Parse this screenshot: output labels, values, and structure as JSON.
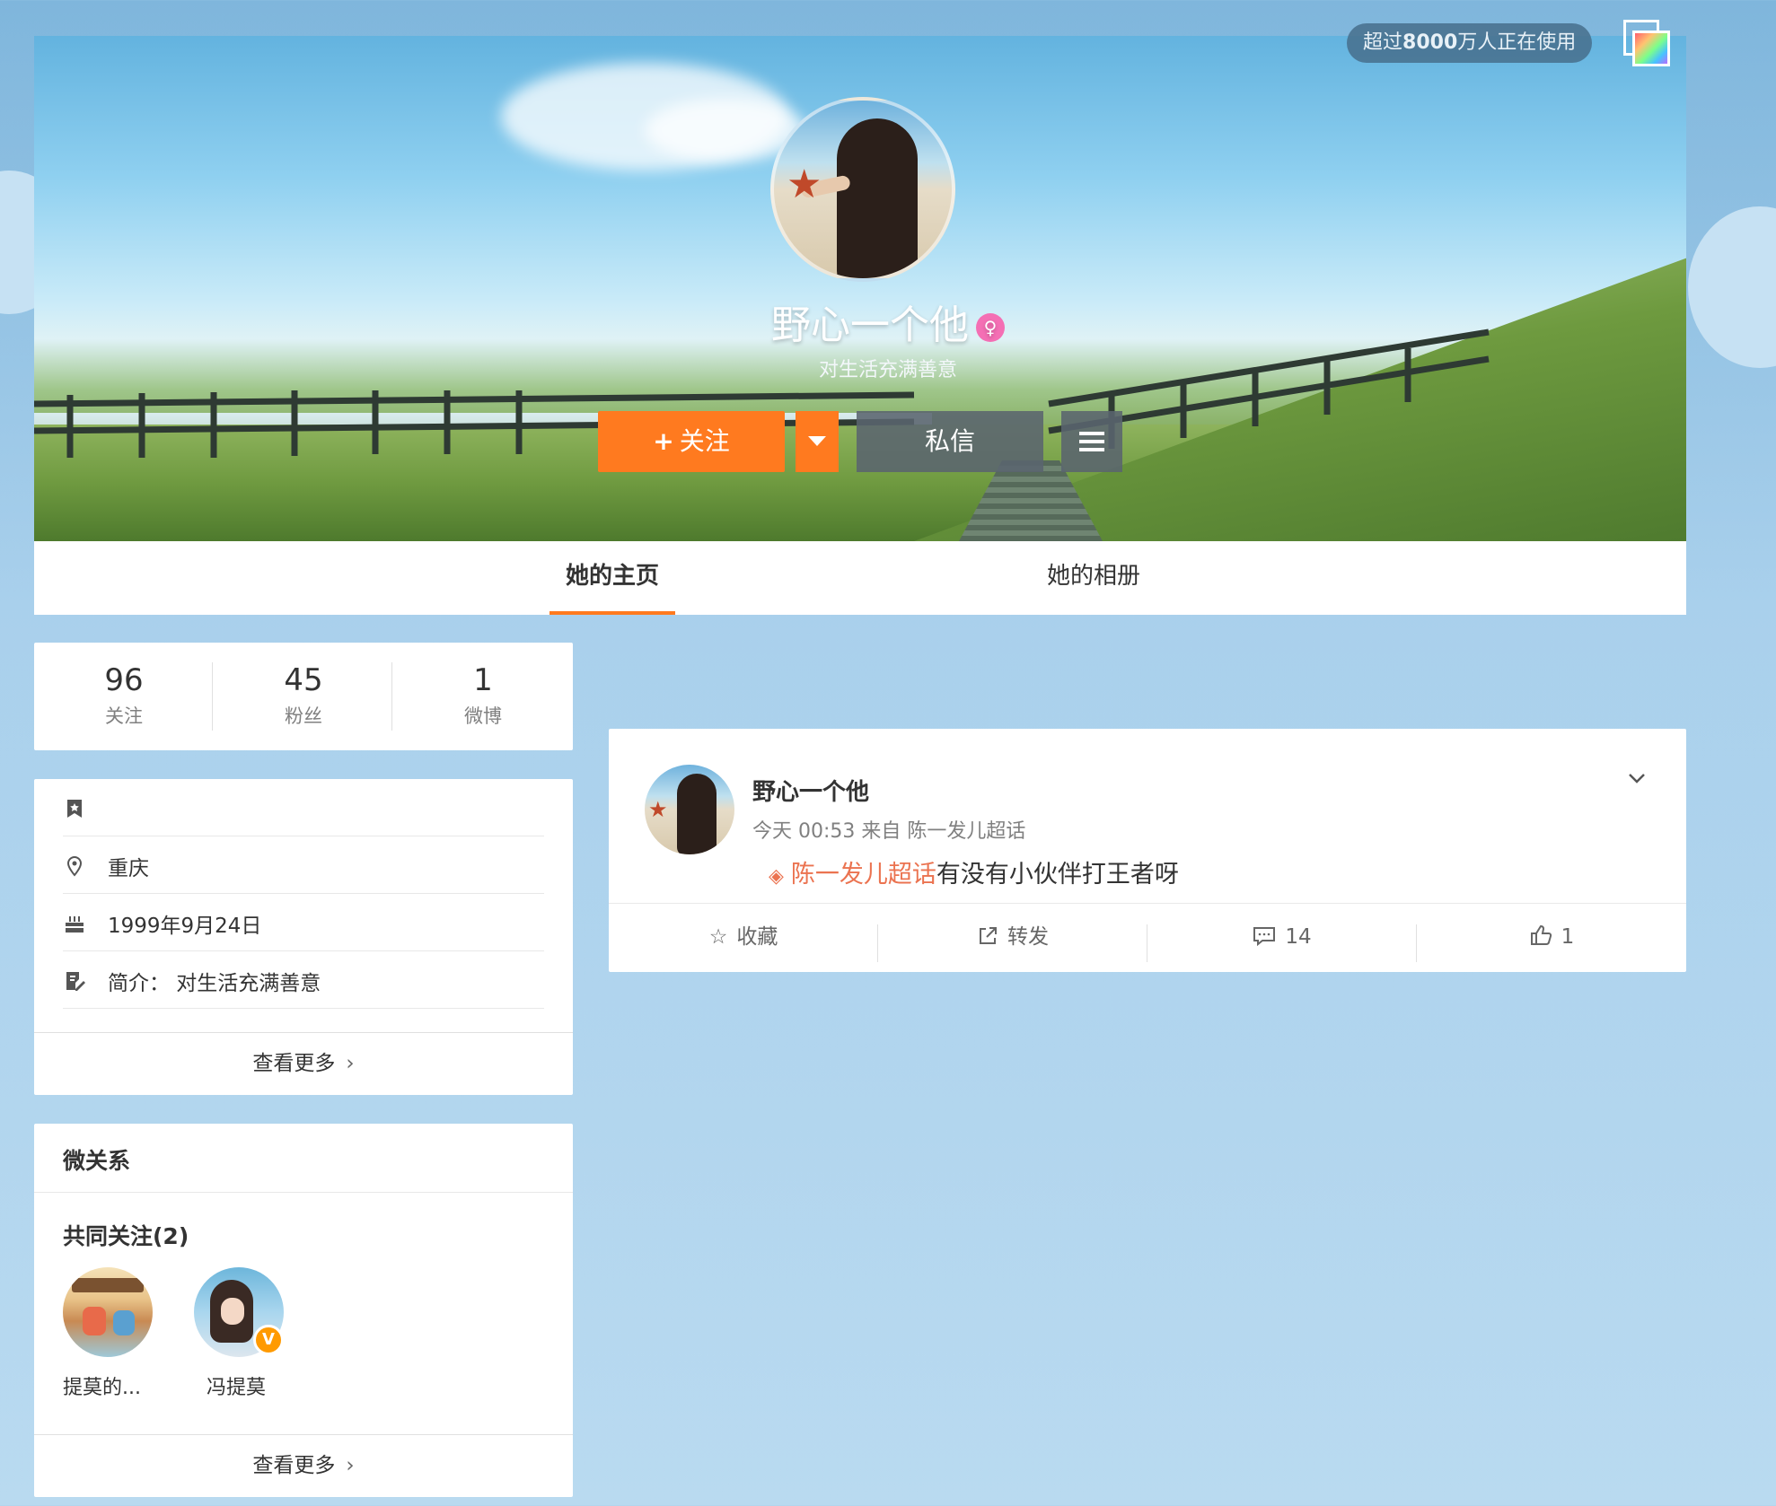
{
  "header": {
    "user_count_prefix": "超过",
    "user_count_num": "8000",
    "user_count_suffix": "万人正在使用"
  },
  "profile": {
    "name": "野心一个他",
    "bio": "对生活充满善意",
    "follow_label": "关注",
    "message_label": "私信"
  },
  "tabs": [
    {
      "label": "她的主页",
      "active": true
    },
    {
      "label": "她的相册",
      "active": false
    }
  ],
  "stats": [
    {
      "num": "96",
      "label": "关注"
    },
    {
      "num": "45",
      "label": "粉丝"
    },
    {
      "num": "1",
      "label": "微博"
    }
  ],
  "info": {
    "location": "重庆",
    "birthday": "1999年9月24日",
    "intro": "简介：  对生活充满善意",
    "more_label": "查看更多"
  },
  "relations": {
    "title": "微关系",
    "common_title": "共同关注(2)",
    "friends": [
      {
        "name": "提莫的..."
      },
      {
        "name": "冯提莫"
      }
    ],
    "more_label": "查看更多"
  },
  "post": {
    "author": "野心一个他",
    "meta": "今天 00:53 来自 陈一发儿超话",
    "topic": "陈一发儿超话",
    "text": "有没有小伙伴打王者呀",
    "actions": {
      "favorite": "收藏",
      "repost": "转发",
      "comments": "14",
      "likes": "1"
    }
  },
  "colors": {
    "accent": "#ff7a1f",
    "topic": "#eb7350"
  }
}
